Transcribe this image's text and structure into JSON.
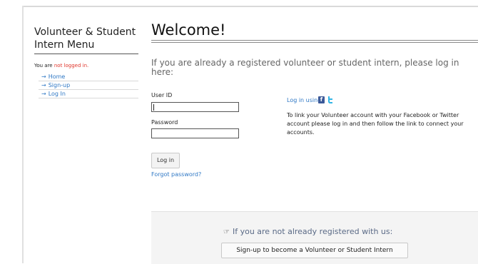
{
  "sidebar": {
    "title_line1": "Volunteer & Student",
    "title_line2": "Intern Menu",
    "status_prefix": "You are ",
    "status_highlight": "not logged in.",
    "items": [
      {
        "arrow": "→",
        "label": "Home"
      },
      {
        "arrow": "→",
        "label": "Sign-up"
      },
      {
        "arrow": "→",
        "label": "Log In"
      }
    ]
  },
  "main": {
    "title": "Welcome!",
    "intro": "If you are already a registered volunteer or student intern, please log in here:",
    "user_label": "User ID",
    "user_value": "",
    "password_label": "Password",
    "password_value": "",
    "login_button": "Log in",
    "forgot_link": "Forgot password?"
  },
  "social": {
    "heading": "Log in using:",
    "facebook_icon": "facebook-icon",
    "twitter_icon": "twitter-icon",
    "description": "To link your Volunteer account with your Facebook or Twitter account please log in and then follow the link to connect your accounts."
  },
  "signup_panel": {
    "hand_icon": "☞",
    "heading": "If you are not already registered with us:",
    "button": "Sign-up to become a Volunteer or Student Intern"
  },
  "colors": {
    "link": "#2f78c5",
    "not_logged_in": "#e0352b",
    "facebook": "#3b5998",
    "twitter": "#33b5e5"
  }
}
